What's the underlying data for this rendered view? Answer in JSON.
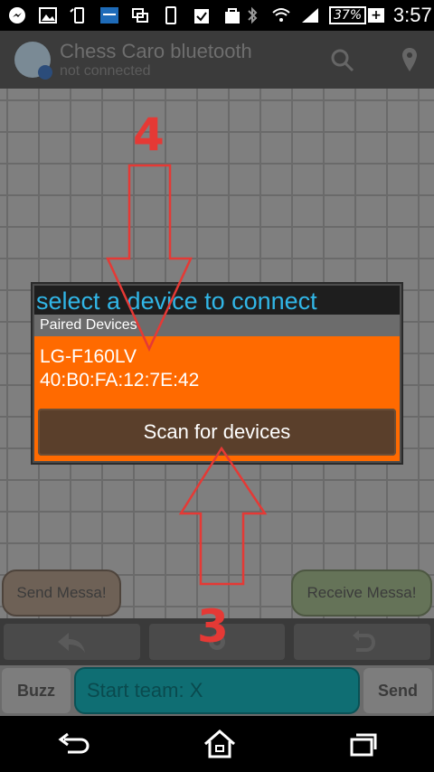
{
  "status_bar": {
    "battery": "37%",
    "time": "3:57"
  },
  "header": {
    "title": "Chess Caro bluetooth",
    "subtitle": "not connected"
  },
  "dialog": {
    "title": "select a device to connect",
    "section_header": "Paired Devices",
    "devices": [
      {
        "name": "LG-F160LV",
        "address": "40:B0:FA:12:7E:42"
      }
    ],
    "scan_button": "Scan for devices"
  },
  "controls": {
    "send_message": "Send Messa!",
    "receive_message": "Receive Messa!",
    "buzz": "Buzz",
    "send": "Send",
    "chat_placeholder": "Start team: X"
  },
  "annotations": {
    "step_top": "4",
    "step_bottom": "3"
  },
  "colors": {
    "accent": "#ff6a00",
    "title_blue": "#31b6e7",
    "annotation_red": "#e53935"
  }
}
